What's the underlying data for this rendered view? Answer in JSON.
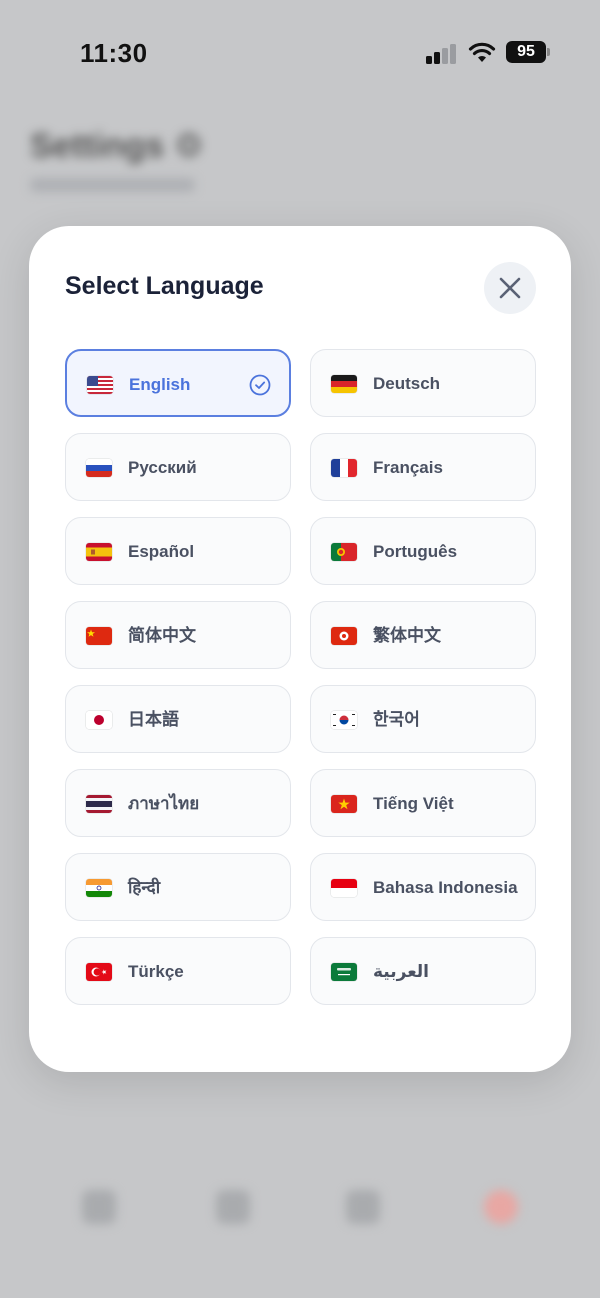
{
  "status_bar": {
    "time": "11:30",
    "battery": "95"
  },
  "background": {
    "title": "Settings ⚙"
  },
  "modal": {
    "title": "Select Language",
    "languages": [
      {
        "label": "English",
        "flag": "us-flag-icon",
        "selected": true
      },
      {
        "label": "Deutsch",
        "flag": "de-flag-icon"
      },
      {
        "label": "Русский",
        "flag": "ru-flag-icon"
      },
      {
        "label": "Français",
        "flag": "fr-flag-icon"
      },
      {
        "label": "Español",
        "flag": "es-flag-icon"
      },
      {
        "label": "Português",
        "flag": "pt-flag-icon"
      },
      {
        "label": "简体中文",
        "flag": "cn-flag-icon"
      },
      {
        "label": "繁体中文",
        "flag": "hk-flag-icon"
      },
      {
        "label": "日本語",
        "flag": "jp-flag-icon"
      },
      {
        "label": "한국어",
        "flag": "kr-flag-icon"
      },
      {
        "label": "ภาษาไทย",
        "flag": "th-flag-icon"
      },
      {
        "label": "Tiếng Việt",
        "flag": "vn-flag-icon"
      },
      {
        "label": "हिन्दी",
        "flag": "in-flag-icon"
      },
      {
        "label": "Bahasa Indonesia",
        "flag": "id-flag-icon"
      },
      {
        "label": "Türkçe",
        "flag": "tr-flag-icon"
      },
      {
        "label": "العربية",
        "flag": "sa-flag-icon"
      }
    ]
  },
  "colors": {
    "accent": "#5b7fe0",
    "title": "#1b2238",
    "text": "#4a5162"
  }
}
